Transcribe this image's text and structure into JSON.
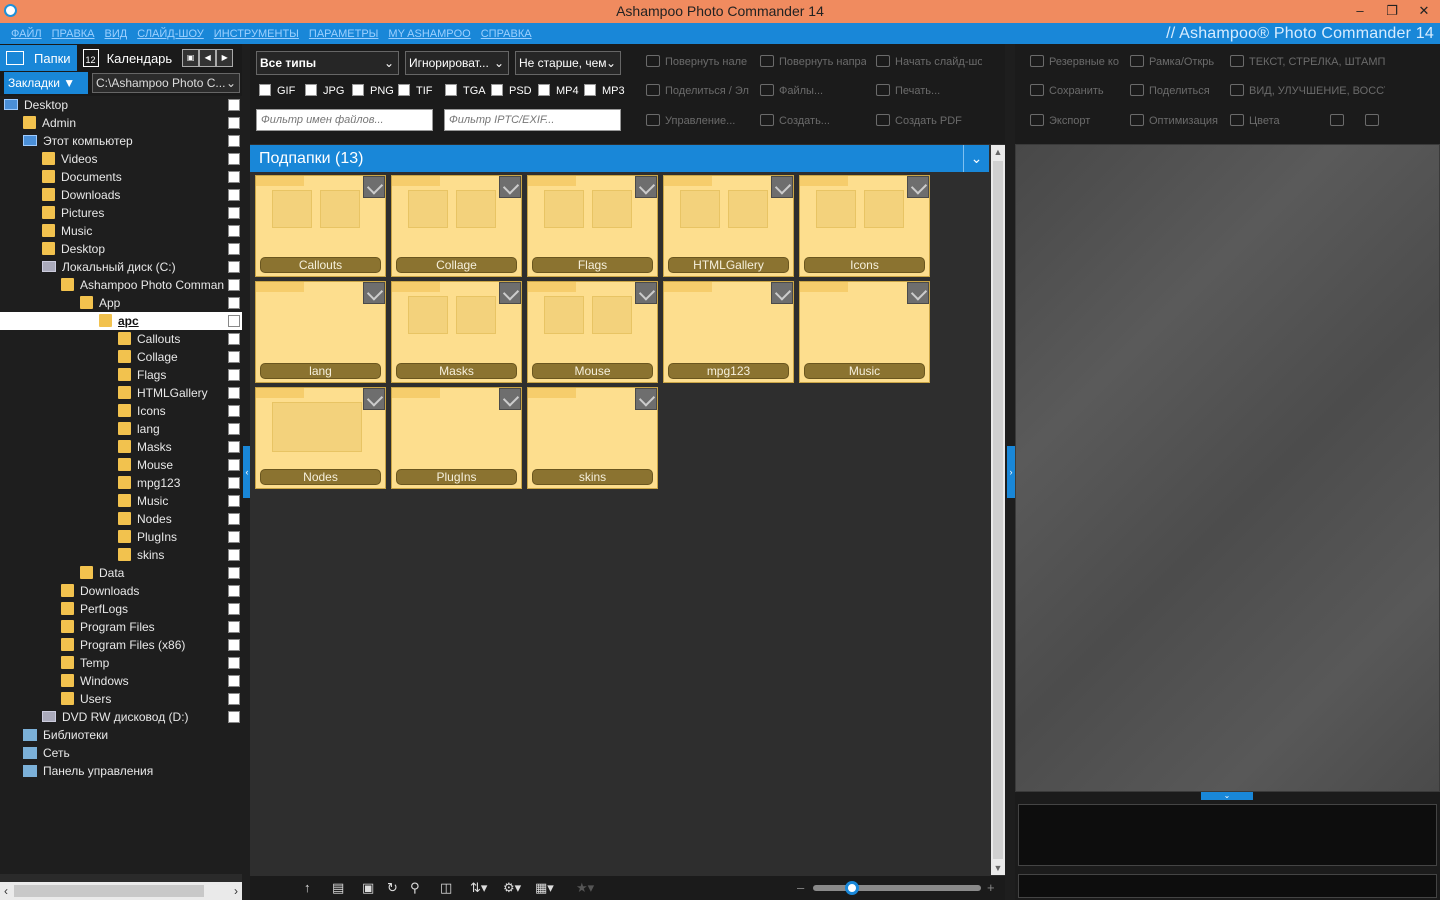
{
  "window": {
    "title": "Ashampoo Photo Commander 14",
    "brand": "// Ashampoo® Photo Commander 14"
  },
  "menu": [
    "ФАЙЛ",
    "ПРАВКА",
    "ВИД",
    "СЛАЙД-ШОУ",
    "ИНСТРУМЕНТЫ",
    "ПАРАМЕТРЫ",
    "MY ASHAMPOO",
    "СПРАВКА"
  ],
  "left": {
    "tabs": {
      "folders": "Папки",
      "calendar": "Календарь",
      "calendar_day": "12"
    },
    "bookmarks": "Закладки",
    "path": "C:\\Ashampoo Photo C...",
    "tree": [
      {
        "label": "Desktop",
        "icon": "pc-icon",
        "indent": 0
      },
      {
        "label": "Admin",
        "icon": "folder-icon",
        "indent": 1
      },
      {
        "label": "Этот компьютер",
        "icon": "pc-icon",
        "indent": 1
      },
      {
        "label": "Videos",
        "icon": "folder-icon",
        "indent": 2
      },
      {
        "label": "Documents",
        "icon": "folder-icon",
        "indent": 2
      },
      {
        "label": "Downloads",
        "icon": "folder-icon",
        "indent": 2
      },
      {
        "label": "Pictures",
        "icon": "folder-icon",
        "indent": 2
      },
      {
        "label": "Music",
        "icon": "folder-icon",
        "indent": 2
      },
      {
        "label": "Desktop",
        "icon": "folder-icon",
        "indent": 2
      },
      {
        "label": "Локальный диск (C:)",
        "icon": "drive-icon",
        "indent": 2
      },
      {
        "label": "Ashampoo Photo Comman",
        "icon": "folder-icon",
        "indent": 3
      },
      {
        "label": "App",
        "icon": "folder-icon",
        "indent": 4
      },
      {
        "label": "apc",
        "icon": "folder-icon",
        "indent": 5,
        "selected": true
      },
      {
        "label": "Callouts",
        "icon": "folder-icon",
        "indent": 6
      },
      {
        "label": "Collage",
        "icon": "folder-icon",
        "indent": 6
      },
      {
        "label": "Flags",
        "icon": "folder-icon",
        "indent": 6
      },
      {
        "label": "HTMLGallery",
        "icon": "folder-icon",
        "indent": 6
      },
      {
        "label": "Icons",
        "icon": "folder-icon",
        "indent": 6
      },
      {
        "label": "lang",
        "icon": "folder-icon",
        "indent": 6
      },
      {
        "label": "Masks",
        "icon": "folder-icon",
        "indent": 6
      },
      {
        "label": "Mouse",
        "icon": "folder-icon",
        "indent": 6
      },
      {
        "label": "mpg123",
        "icon": "folder-icon",
        "indent": 6
      },
      {
        "label": "Music",
        "icon": "folder-icon",
        "indent": 6
      },
      {
        "label": "Nodes",
        "icon": "folder-icon",
        "indent": 6
      },
      {
        "label": "PlugIns",
        "icon": "folder-icon",
        "indent": 6
      },
      {
        "label": "skins",
        "icon": "folder-icon",
        "indent": 6
      },
      {
        "label": "Data",
        "icon": "folder-icon",
        "indent": 4
      },
      {
        "label": "Downloads",
        "icon": "folder-icon",
        "indent": 3
      },
      {
        "label": "PerfLogs",
        "icon": "folder-icon",
        "indent": 3
      },
      {
        "label": "Program Files",
        "icon": "folder-icon",
        "indent": 3
      },
      {
        "label": "Program Files (x86)",
        "icon": "folder-icon",
        "indent": 3
      },
      {
        "label": "Temp",
        "icon": "folder-icon",
        "indent": 3
      },
      {
        "label": "Windows",
        "icon": "folder-icon",
        "indent": 3
      },
      {
        "label": "Users",
        "icon": "folder-icon",
        "indent": 3
      },
      {
        "label": "DVD RW дисковод (D:)",
        "icon": "drive-icon",
        "indent": 2
      },
      {
        "label": "Библиотеки",
        "icon": "group-icon",
        "indent": 1
      },
      {
        "label": "Сеть",
        "icon": "group-icon",
        "indent": 1
      },
      {
        "label": "Панель управления",
        "icon": "group-icon",
        "indent": 1
      }
    ]
  },
  "toolbar": {
    "type_select": "Все типы",
    "ignore_select": "Игнорироват...",
    "age_select": "Не старше, чем",
    "types": [
      "GIF",
      "JPG",
      "PNG",
      "TIF",
      "TGA",
      "PSD",
      "MP4",
      "MP3"
    ],
    "name_filter_placeholder": "Фильтр имен файлов...",
    "iptc_filter_placeholder": "Фильтр IPTC/EXIF...",
    "actions": [
      [
        "Повернуть нале",
        "Повернуть напра",
        "Начать слайд-шо"
      ],
      [
        "Поделиться / Эл",
        "Файлы...",
        "Печать..."
      ],
      [
        "Управление...",
        "Создать...",
        "Создать PDF"
      ]
    ]
  },
  "subfolders": {
    "header": "Подпапки (13)",
    "items": [
      "Callouts",
      "Collage",
      "Flags",
      "HTMLGallery",
      "Icons",
      "lang",
      "Masks",
      "Mouse",
      "mpg123",
      "Music",
      "Nodes",
      "PlugIns",
      "skins"
    ]
  },
  "right": {
    "actions": [
      [
        "Резервные ко",
        "Рамка/Открь",
        "ТЕКСТ, СТРЕЛКА, ШТАМП,"
      ],
      [
        "Сохранить",
        "Поделиться",
        "ВИД, УЛУЧШЕНИЕ, ВОССТА"
      ],
      [
        "Экспорт",
        "Оптимизация",
        "Цвета"
      ]
    ]
  },
  "colors": {
    "accent": "#1987d8",
    "titlebar": "#f08b5f",
    "folder": "#fdde8e"
  }
}
